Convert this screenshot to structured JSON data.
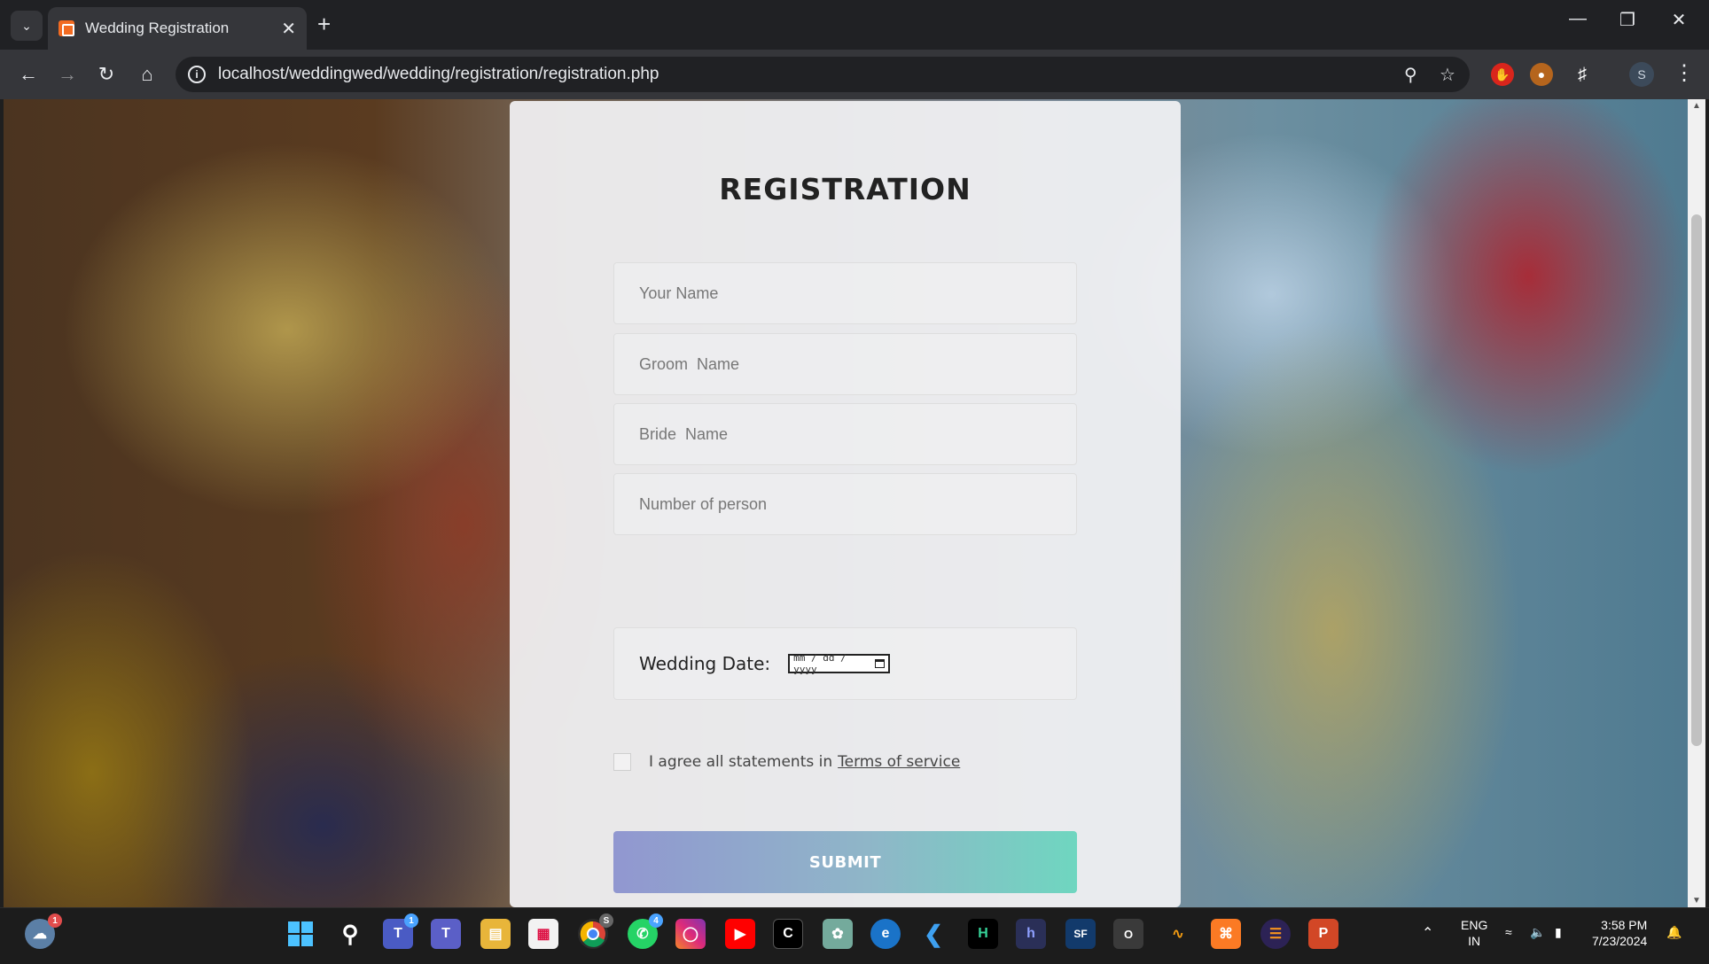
{
  "browser": {
    "tab_title": "Wedding Registration",
    "url": "localhost/weddingwed/wedding/registration/registration.php"
  },
  "form": {
    "heading": "REGISTRATION",
    "your_name_placeholder": "Your Name",
    "groom_name_placeholder": "Groom  Name",
    "bride_name_placeholder": "Bride  Name",
    "persons_placeholder": "Number of person",
    "wedding_date_label": "Wedding Date:",
    "date_input_placeholder": "mm / dd / yyyy",
    "agree_text": "I agree all statements in",
    "terms_link": "Terms of service",
    "submit_label": "SUBMIT"
  },
  "taskbar": {
    "weather_badge": "1",
    "teams_badge": "1",
    "chrome_badge": "S",
    "whatsapp_badge": "4",
    "language_primary": "ENG",
    "language_secondary": "IN",
    "time": "3:58 PM",
    "date": "7/23/2024"
  },
  "icons": [
    "dropdown-icon",
    "tab-close-icon",
    "new-tab-icon",
    "minimize-icon",
    "restore-icon",
    "close-window-icon",
    "back-icon",
    "forward-icon",
    "reload-icon",
    "home-icon",
    "site-info-icon",
    "zoom-icon",
    "bookmark-star-icon",
    "extension-icon",
    "profile-avatar",
    "menu-icon",
    "calendar-icon",
    "windows-start-icon",
    "search-icon"
  ],
  "colors": {
    "chrome_dark": "#202124",
    "chrome_mid": "#35363a",
    "card_bg": "#f2f2f4",
    "submit_gradient_start": "#9197d0",
    "submit_gradient_end": "#6fd6c0",
    "taskbar": "#1c1c1c"
  }
}
